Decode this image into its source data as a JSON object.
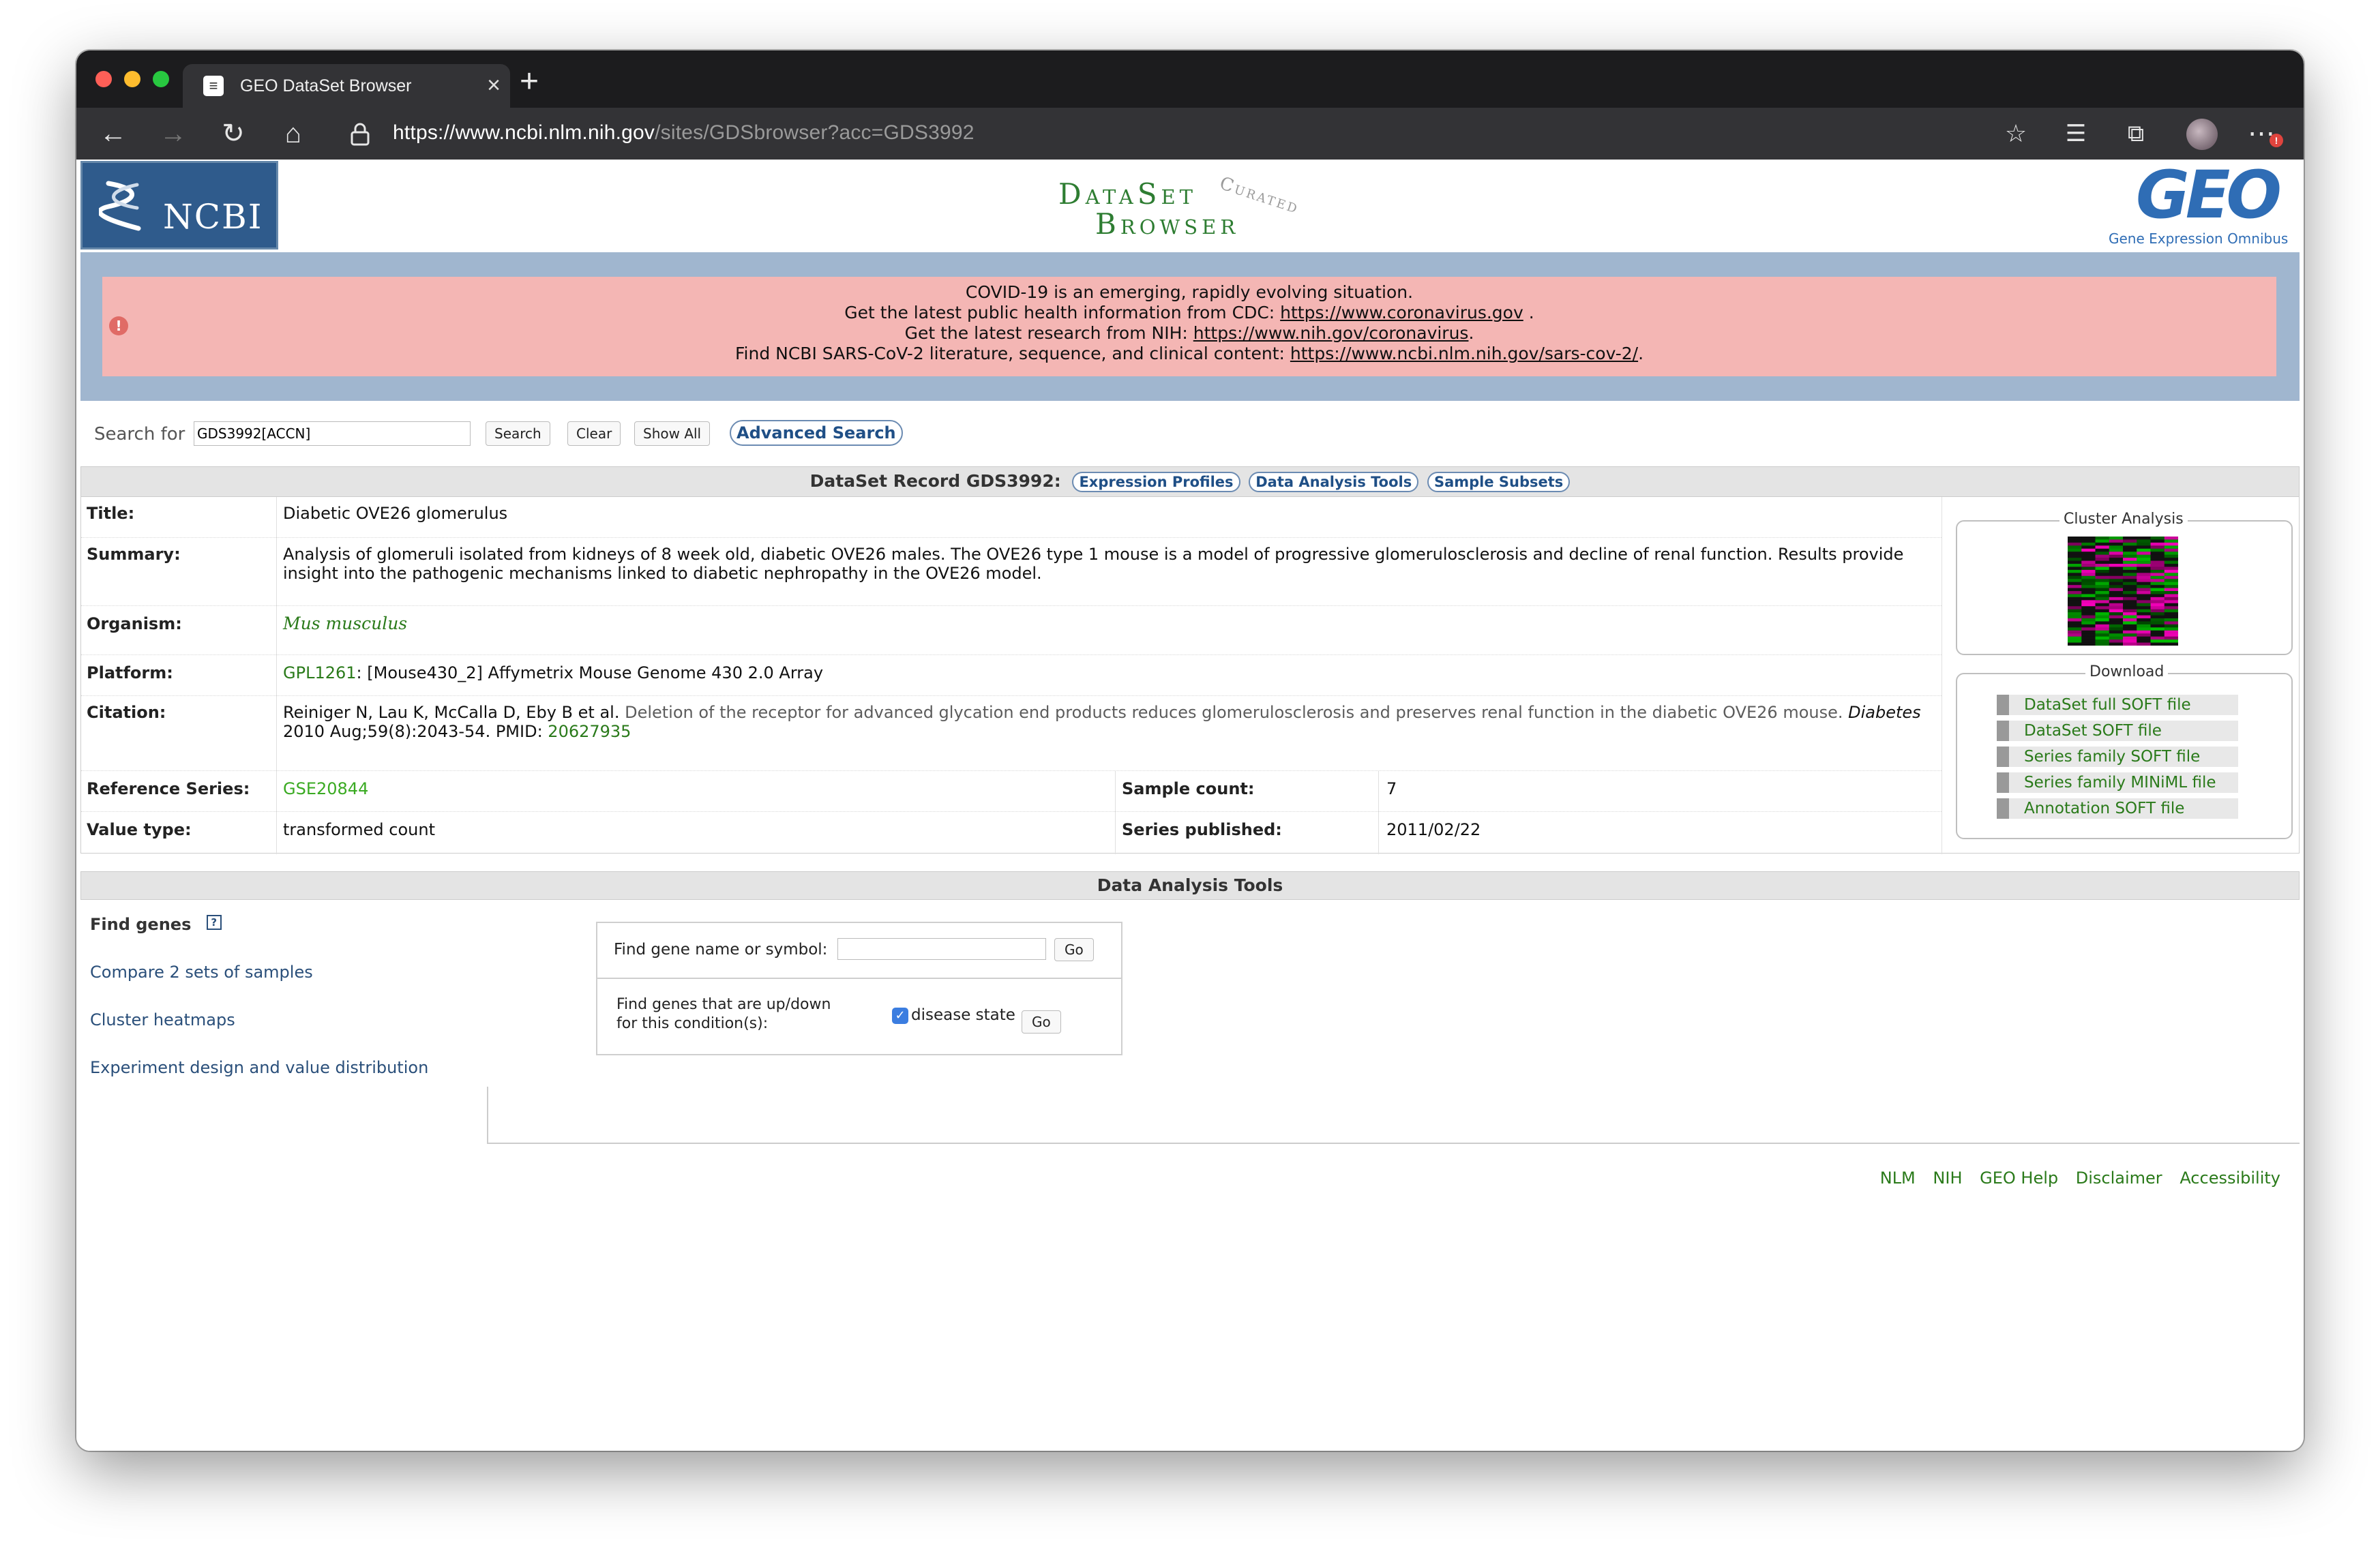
{
  "browser": {
    "tab_title": "GEO DataSet Browser",
    "url_host": "https://www.ncbi.nlm.nih.gov",
    "url_path": "/sites/GDSbrowser?acc=GDS3992"
  },
  "header": {
    "ncbi_logo_text": "NCBI",
    "dataset_logo_line1": "DataSet",
    "dataset_logo_line2": "Browser",
    "dataset_logo_curated": "Curated",
    "geo_logo_text": "GEO",
    "geo_subtitle": "Gene Expression Omnibus"
  },
  "alert": {
    "line1": "COVID-19 is an emerging, rapidly evolving situation.",
    "line2_prefix": "Get the latest public health information from CDC: ",
    "line2_link": "https://www.coronavirus.gov",
    "line2_suffix": " .",
    "line3_prefix": "Get the latest research from NIH: ",
    "line3_link": "https://www.nih.gov/coronavirus",
    "line3_suffix": ".",
    "line4_prefix": "Find NCBI SARS-CoV-2 literature, sequence, and clinical content: ",
    "line4_link": "https://www.ncbi.nlm.nih.gov/sars-cov-2/",
    "line4_suffix": "."
  },
  "search": {
    "label": "Search for",
    "value": "GDS3992[ACCN]",
    "search_button": "Search",
    "clear_button": "Clear",
    "show_all_button": "Show All",
    "advanced_button": "Advanced Search"
  },
  "record": {
    "heading": "DataSet Record GDS3992:",
    "tabs": [
      "Expression Profiles",
      "Data Analysis Tools",
      "Sample Subsets"
    ],
    "title_label": "Title:",
    "title_value": "Diabetic OVE26 glomerulus",
    "summary_label": "Summary:",
    "summary_value": "Analysis of glomeruli isolated from kidneys of 8 week old, diabetic OVE26 males. The OVE26 type 1 mouse is a model of progressive glomerulosclerosis and decline of renal function. Results provide insight into the pathogenic mechanisms linked to diabetic nephropathy in the OVE26 model.",
    "organism_label": "Organism:",
    "organism_value": "Mus musculus",
    "platform_label": "Platform:",
    "platform_id": "GPL1261",
    "platform_value": ": [Mouse430_2] Affymetrix Mouse Genome 430 2.0 Array",
    "citation_label": "Citation:",
    "citation_authors": "Reiniger N, Lau K, McCalla D, Eby B et al.",
    "citation_title": "Deletion of the receptor for advanced glycation end products reduces glomerulosclerosis and preserves renal function in the diabetic OVE26 mouse.",
    "citation_journal": "Diabetes",
    "citation_year": "2010",
    "citation_issue": "Aug;59(8):2043-54. PMID:",
    "citation_pmid": "20627935",
    "ref_series_label": "Reference Series:",
    "ref_series_value": "GSE20844",
    "sample_count_label": "Sample count:",
    "sample_count_value": "7",
    "value_type_label": "Value type:",
    "value_type_value": "transformed count",
    "series_published_label": "Series published:",
    "series_published_value": "2011/02/22"
  },
  "sidebar": {
    "cluster_legend": "Cluster Analysis",
    "download_legend": "Download",
    "downloads": [
      "DataSet full SOFT file",
      "DataSet SOFT file",
      "Series family SOFT file",
      "Series family MINiML file",
      "Annotation SOFT file"
    ]
  },
  "tools": {
    "heading": "Data Analysis Tools",
    "find_genes": "Find genes",
    "help_glyph": "?",
    "compare": "Compare 2 sets of samples",
    "cluster": "Cluster heatmaps",
    "experiment": "Experiment design and value distribution",
    "find_name_label": "Find gene name or symbol:",
    "go_label": "Go",
    "updown_line1": "Find genes that are up/down",
    "updown_line2": "for this condition(s):",
    "condition": "disease state"
  },
  "footer": [
    "NLM",
    "NIH",
    "GEO Help",
    "Disclaimer",
    "Accessibility"
  ]
}
